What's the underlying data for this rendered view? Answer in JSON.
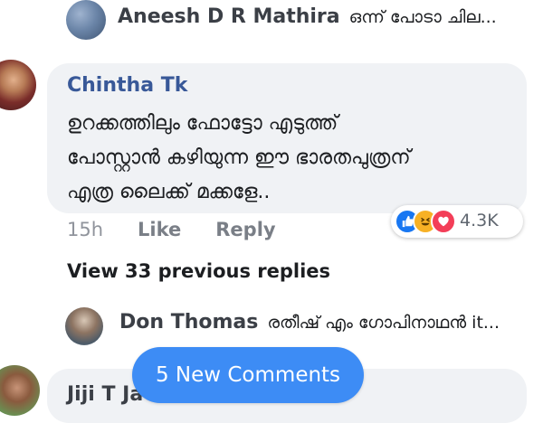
{
  "replies": [
    {
      "name": "Aneesh D R Mathira",
      "text": "ഒന്ന് പോടാ ചില..."
    },
    {
      "name": "Don Thomas",
      "text": "രതീഷ് എം ഗോപിനാഥൻ it..."
    }
  ],
  "comment": {
    "author": "Chintha Tk",
    "lines": [
      "ഉറക്കത്തിലും ഫോട്ടോ എടുത്ത്",
      "പോസ്റ്റാൻ കഴിയുന്ന ഈ ഭാരതപുത്രന്",
      "എത്ര ലൈക്ക് മക്കളേ.."
    ],
    "time": "15h",
    "like_label": "Like",
    "reply_label": "Reply",
    "reactions": {
      "icons": [
        "like-icon",
        "haha-icon",
        "love-icon"
      ],
      "count": "4.3K"
    }
  },
  "view_previous": "View 33 previous replies",
  "next_comment": {
    "author": "Jiji T Ja"
  },
  "new_comments_button": "5 New Comments",
  "colors": {
    "bubble": "#f0f2f5",
    "link_blue": "#385898",
    "pill": "#3d8cf5"
  }
}
